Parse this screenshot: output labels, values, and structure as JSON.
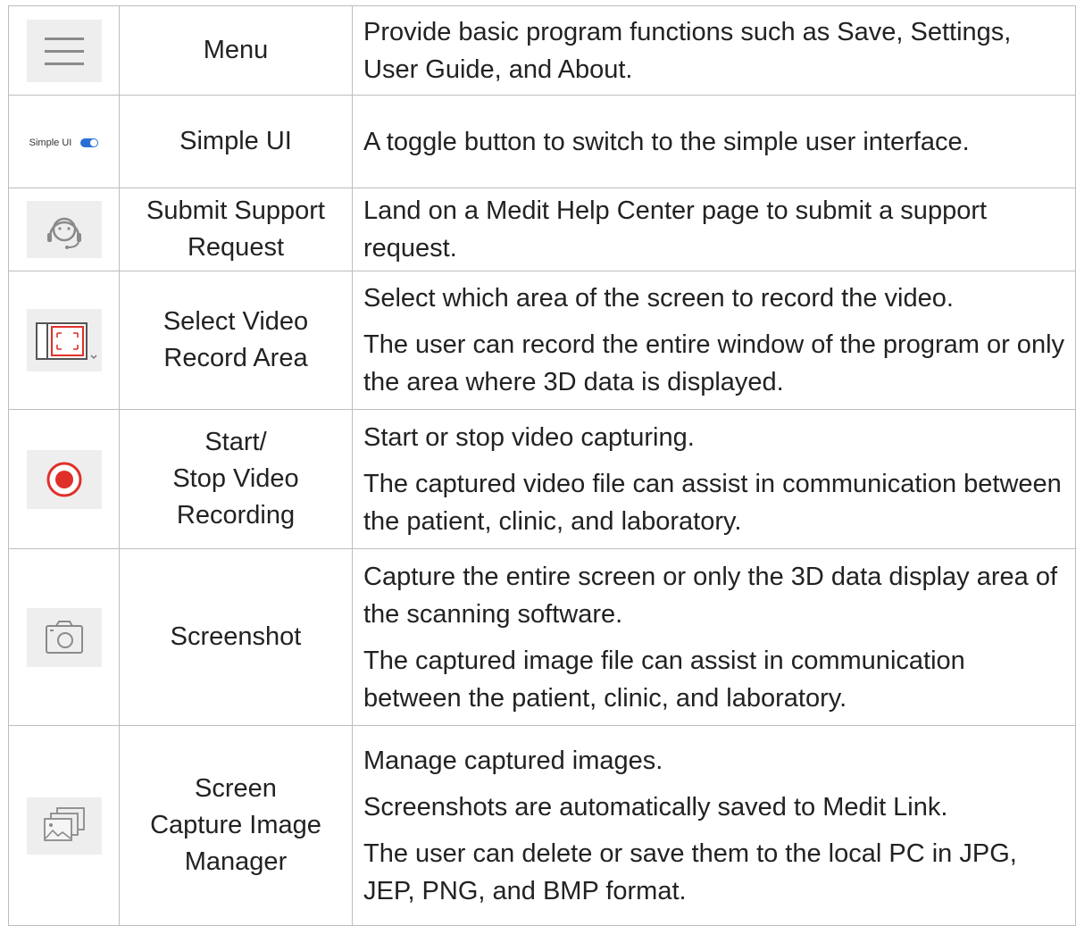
{
  "rows": [
    {
      "icon": "menu-icon",
      "name": [
        "Menu"
      ],
      "desc": [
        "Provide basic program functions such as Save, Settings, User Guide, and About."
      ]
    },
    {
      "icon": "simple-ui-toggle-icon",
      "icon_label": "Simple UI",
      "name": [
        "Simple UI"
      ],
      "desc": [
        "A toggle button to switch to the simple user interface."
      ]
    },
    {
      "icon": "headset-icon",
      "name": [
        "Submit Support",
        "Request"
      ],
      "desc": [
        "Land on a Medit Help Center page to submit a support request."
      ]
    },
    {
      "icon": "record-area-icon",
      "name": [
        "Select Video",
        "Record Area"
      ],
      "desc": [
        "Select which area of the screen to record the video.",
        "The user can record the entire window of the program or only the area where 3D data is displayed."
      ]
    },
    {
      "icon": "record-icon",
      "name": [
        "Start/",
        "Stop Video",
        "Recording"
      ],
      "desc": [
        "Start or stop video capturing.",
        "The captured video file can assist in communication between the patient, clinic, and laboratory."
      ]
    },
    {
      "icon": "camera-icon",
      "name": [
        "Screenshot"
      ],
      "desc": [
        "Capture the entire screen or only the 3D data display area of the scanning software.",
        "The captured image file can assist in communication between the patient, clinic, and laboratory."
      ]
    },
    {
      "icon": "image-stack-icon",
      "name": [
        "Screen",
        "Capture Image",
        "Manager"
      ],
      "desc": [
        "Manage captured images.",
        "Screenshots are automatically saved to Medit Link.",
        "The user can delete or save them to the local PC in JPG, JEP, PNG, and BMP format."
      ]
    }
  ],
  "colors": {
    "record_red": "#e0302a",
    "toggle_blue": "#2b6fd6",
    "icon_bg": "#eeeeee",
    "border": "#bdbdbd"
  }
}
